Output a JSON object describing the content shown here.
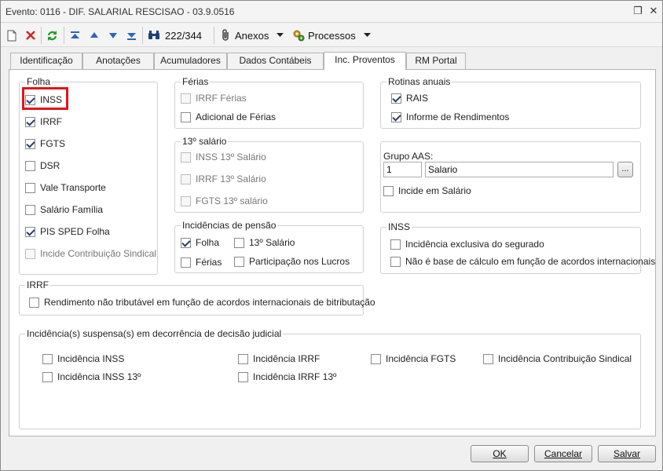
{
  "window": {
    "title": "Evento: 0116 - DIF. SALARIAL RESCISAO - 03.9.0516",
    "restore_glyph": "❐",
    "close_glyph": "✕"
  },
  "toolbar": {
    "new_icon": "new-document-icon",
    "delete_icon": "delete-icon",
    "refresh_icon": "refresh-icon",
    "record_counter": "222/344",
    "attachments_label": "Anexos",
    "processes_label": "Processos"
  },
  "tabs": [
    "Identificação",
    "Anotações",
    "Acumuladores",
    "Dados Contábeis",
    "Inc. Proventos",
    "RM Portal"
  ],
  "active_tab": "Inc. Proventos",
  "folha": {
    "title": "Folha",
    "items": [
      {
        "label": "INSS",
        "checked": true
      },
      {
        "label": "IRRF",
        "checked": true
      },
      {
        "label": "FGTS",
        "checked": true
      },
      {
        "label": "DSR",
        "checked": false
      },
      {
        "label": "Vale Transporte",
        "checked": false
      },
      {
        "label": "Salário Família",
        "checked": false
      },
      {
        "label": "PIS SPED Folha",
        "checked": true
      },
      {
        "label": "Incide Contribuição Sindical",
        "checked": false
      }
    ]
  },
  "ferias": {
    "title": "Férias",
    "items": [
      {
        "label": "IRRF Férias",
        "checked": false
      },
      {
        "label": "Adicional de Férias",
        "checked": false
      }
    ]
  },
  "decimo": {
    "title": "13º salário",
    "items": [
      {
        "label": "INSS 13º Salário",
        "checked": false
      },
      {
        "label": "IRRF 13º Salário",
        "checked": false
      },
      {
        "label": "FGTS 13º salário",
        "checked": false
      }
    ]
  },
  "pensao": {
    "title": "Incidências de pensão",
    "items": [
      {
        "label": "Folha",
        "checked": true
      },
      {
        "label": "13º Salário",
        "checked": false
      },
      {
        "label": "Férias",
        "checked": false
      },
      {
        "label": "Participação nos Lucros",
        "checked": false
      }
    ]
  },
  "rotinas": {
    "title": "Rotinas anuais",
    "items": [
      {
        "label": "RAIS",
        "checked": true
      },
      {
        "label": "Informe de Rendimentos",
        "checked": true
      }
    ]
  },
  "aas": {
    "label": "Grupo AAS:",
    "code": "1",
    "name": "Salario",
    "browse_label": "...",
    "incide_label": "Incide em Salário"
  },
  "inss": {
    "title": "INSS",
    "items": [
      {
        "label": "Incidência exclusiva do segurado",
        "checked": false
      },
      {
        "label": "Não é base de cálculo em função de acordos internacionais",
        "checked": false
      }
    ]
  },
  "irrf": {
    "title": "IRRF",
    "items": [
      {
        "label": "Rendimento não tributável em função de acordos internacionais de bitributação",
        "checked": false
      }
    ]
  },
  "suspensas": {
    "title": "Incidência(s) suspensa(s) em decorrência de decisão judicial",
    "items": [
      {
        "label": "Incidência INSS",
        "checked": false
      },
      {
        "label": "Incidência IRRF",
        "checked": false
      },
      {
        "label": "Incidência FGTS",
        "checked": false
      },
      {
        "label": "Incidência Contribuição Sindical",
        "checked": false
      },
      {
        "label": "Incidência INSS 13º",
        "checked": false
      },
      {
        "label": "Incidência IRRF 13º",
        "checked": false
      }
    ]
  },
  "footer": {
    "ok_label": "OK",
    "cancel_label": "Cancelar",
    "save_label": "Salvar"
  },
  "colors": {
    "highlight": "#e0151b",
    "delete_red": "#d92121",
    "nav_blue": "#2f63c0",
    "refresh_green": "#2a9a2a"
  }
}
